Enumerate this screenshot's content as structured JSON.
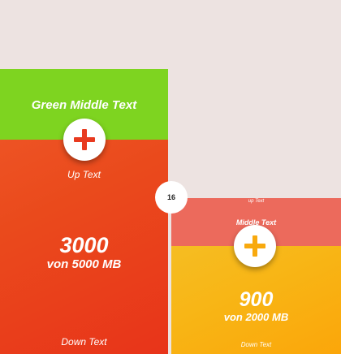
{
  "colors": {
    "background": "#ede3e1",
    "left_card": "#eb4a1f",
    "left_band": "#7ed420",
    "left_plus": "#e83a1f",
    "right_card": "#f8b515",
    "right_band": "#ec6a5c",
    "right_plus": "#f8a90e"
  },
  "left_card": {
    "middle_text": "Green Middle Text",
    "up_text": "Up Text",
    "big_value": "3000",
    "of_value": "von 5000 MB",
    "down_text": "Down Text",
    "fab_icon": "plus-icon"
  },
  "right_card": {
    "up_text": "up Text",
    "middle_text": "Middle Text",
    "big_value": "900",
    "of_value": "von 2000 MB",
    "down_text": "Down Text",
    "fab_icon": "plus-icon"
  },
  "badge": {
    "value": "16"
  }
}
